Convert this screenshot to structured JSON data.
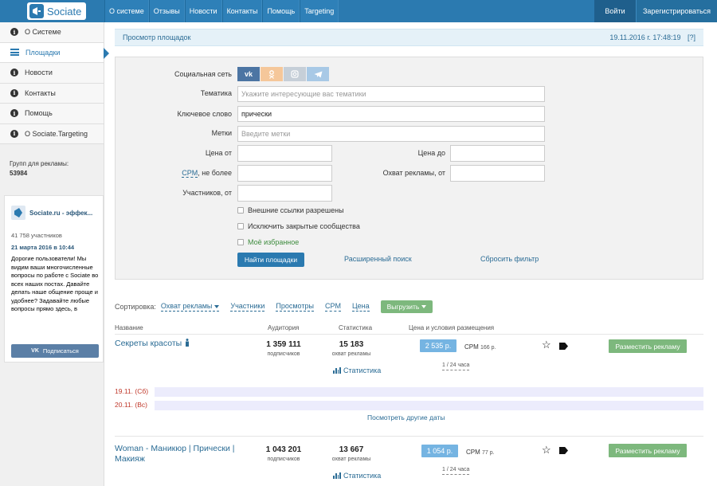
{
  "brand": {
    "logo_text": "Sociate"
  },
  "topnav": [
    "О системе",
    "Отзывы",
    "Новости",
    "Контакты",
    "Помощь",
    "Targeting"
  ],
  "auth": {
    "login": "Войти",
    "register": "Зарегистрироваться"
  },
  "sidebar": {
    "items": [
      {
        "label": "О Системе",
        "icon": "info-icon"
      },
      {
        "label": "Площадки",
        "icon": "list-icon",
        "active": true
      },
      {
        "label": "Новости",
        "icon": "info-icon"
      },
      {
        "label": "Контакты",
        "icon": "info-icon"
      },
      {
        "label": "Помощь",
        "icon": "info-icon"
      },
      {
        "label": "О Sociate.Targeting",
        "icon": "info-icon"
      }
    ],
    "groups_label": "Групп для рекламы:",
    "groups_count": "53984"
  },
  "vk_widget": {
    "name": "Sociate.ru - эффек...",
    "members": "41 758 участников",
    "date": "21 марта 2016 в 10:44",
    "post": "Дорогие пользователи! Мы видим ваши многочисленные вопросы по работе с Sociate во всех наших постах. Давайте делать наше общение проще и удобнее? Задавайте любые вопросы прямо здесь, в",
    "subscribe_logo": "VK",
    "subscribe": "Подписаться"
  },
  "header": {
    "title": "Просмотр площадок",
    "datetime": "19.11.2016 г. 17:48:19",
    "help": "[?]"
  },
  "filters": {
    "social_label": "Социальная сеть",
    "social_icons": {
      "vk": "vk",
      "ok": "ok-icon",
      "ig": "instagram-icon",
      "tg": "telegram-icon"
    },
    "theme_label": "Тематика",
    "theme_placeholder": "Укажите интересующие вас тематики",
    "keyword_label": "Ключевое слово",
    "keyword_value": "прически",
    "tags_label": "Метки",
    "tags_placeholder": "Введите метки",
    "price_from_label": "Цена от",
    "price_to_label": "Цена до",
    "cpm_label_prefix": "CPM",
    "cpm_label_suffix": ", не более",
    "reach_label": "Охват рекламы, от",
    "members_label": "Участников, от",
    "chk_external": "Внешние ссылки разрешены",
    "chk_closed": "Исключить закрытые сообщества",
    "chk_favorites": "Моё избранное",
    "find_button": "Найти площадки",
    "advanced_link": "Расширенный поиск",
    "reset_link": "Сбросить фильтр"
  },
  "sorting": {
    "label": "Сортировка:",
    "options": [
      "Охват рекламы",
      "Участники",
      "Просмотры",
      "CPM",
      "Цена"
    ],
    "export": "Выгрузить"
  },
  "table": {
    "headers": {
      "name": "Название",
      "audience": "Аудитория",
      "stats": "Статистика",
      "price": "Цена и условия размещения"
    },
    "rows": [
      {
        "name_line1": "Секреты красоты",
        "name_line2": "",
        "audience": "1 359 111",
        "audience_sub": "подписчиков",
        "reach": "15 183",
        "reach_sub": "охват рекламы",
        "stats_link": "Статистика",
        "price": "2 535 р.",
        "cpm_label": "CPM",
        "cpm_value": "166 р.",
        "period": "1 / 24 часа",
        "place_button": "Разместить рекламу"
      },
      {
        "name_line1": "Woman - Маникюр | Прически |",
        "name_line2": "Макияж",
        "audience": "1 043 201",
        "audience_sub": "подписчиков",
        "reach": "13 667",
        "reach_sub": "охват рекламы",
        "stats_link": "Статистика",
        "price": "1 054 р.",
        "cpm_label": "CPM",
        "cpm_value": "77 р.",
        "period": "1 / 24 часа",
        "place_button": "Разместить рекламу"
      }
    ],
    "dates": [
      "19.11. (Сб)",
      "20.11. (Вс)"
    ],
    "other_dates": "Посмотреть другие даты"
  }
}
